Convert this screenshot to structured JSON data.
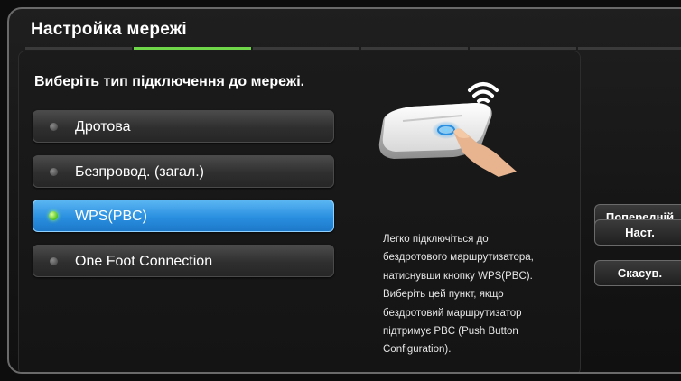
{
  "window": {
    "title": "Настройка мережі"
  },
  "prompt": "Виберіть тип підключення до мережі.",
  "options": [
    {
      "label": "Дротова",
      "selected": false
    },
    {
      "label": "Безпровод. (загал.)",
      "selected": false
    },
    {
      "label": "WPS(PBC)",
      "selected": true
    },
    {
      "label": "One Foot Connection",
      "selected": false
    }
  ],
  "description": "Легко підключіться до\nбездротового маршрутизатора,\nнатиснувши кнопку WPS(PBC).\nВиберіть цей пункт, якщо\nбездротовий маршрутизатор\nпідтримує PBC (Push Button\nConfiguration).",
  "buttons": {
    "previous": "Попередній",
    "next": "Наст.",
    "cancel": "Скасув."
  },
  "illustration": {
    "icon": "wifi-router-push-icon"
  },
  "colors": {
    "selected_accent": "#2a8fe0",
    "active_step": "#6fd64a"
  }
}
